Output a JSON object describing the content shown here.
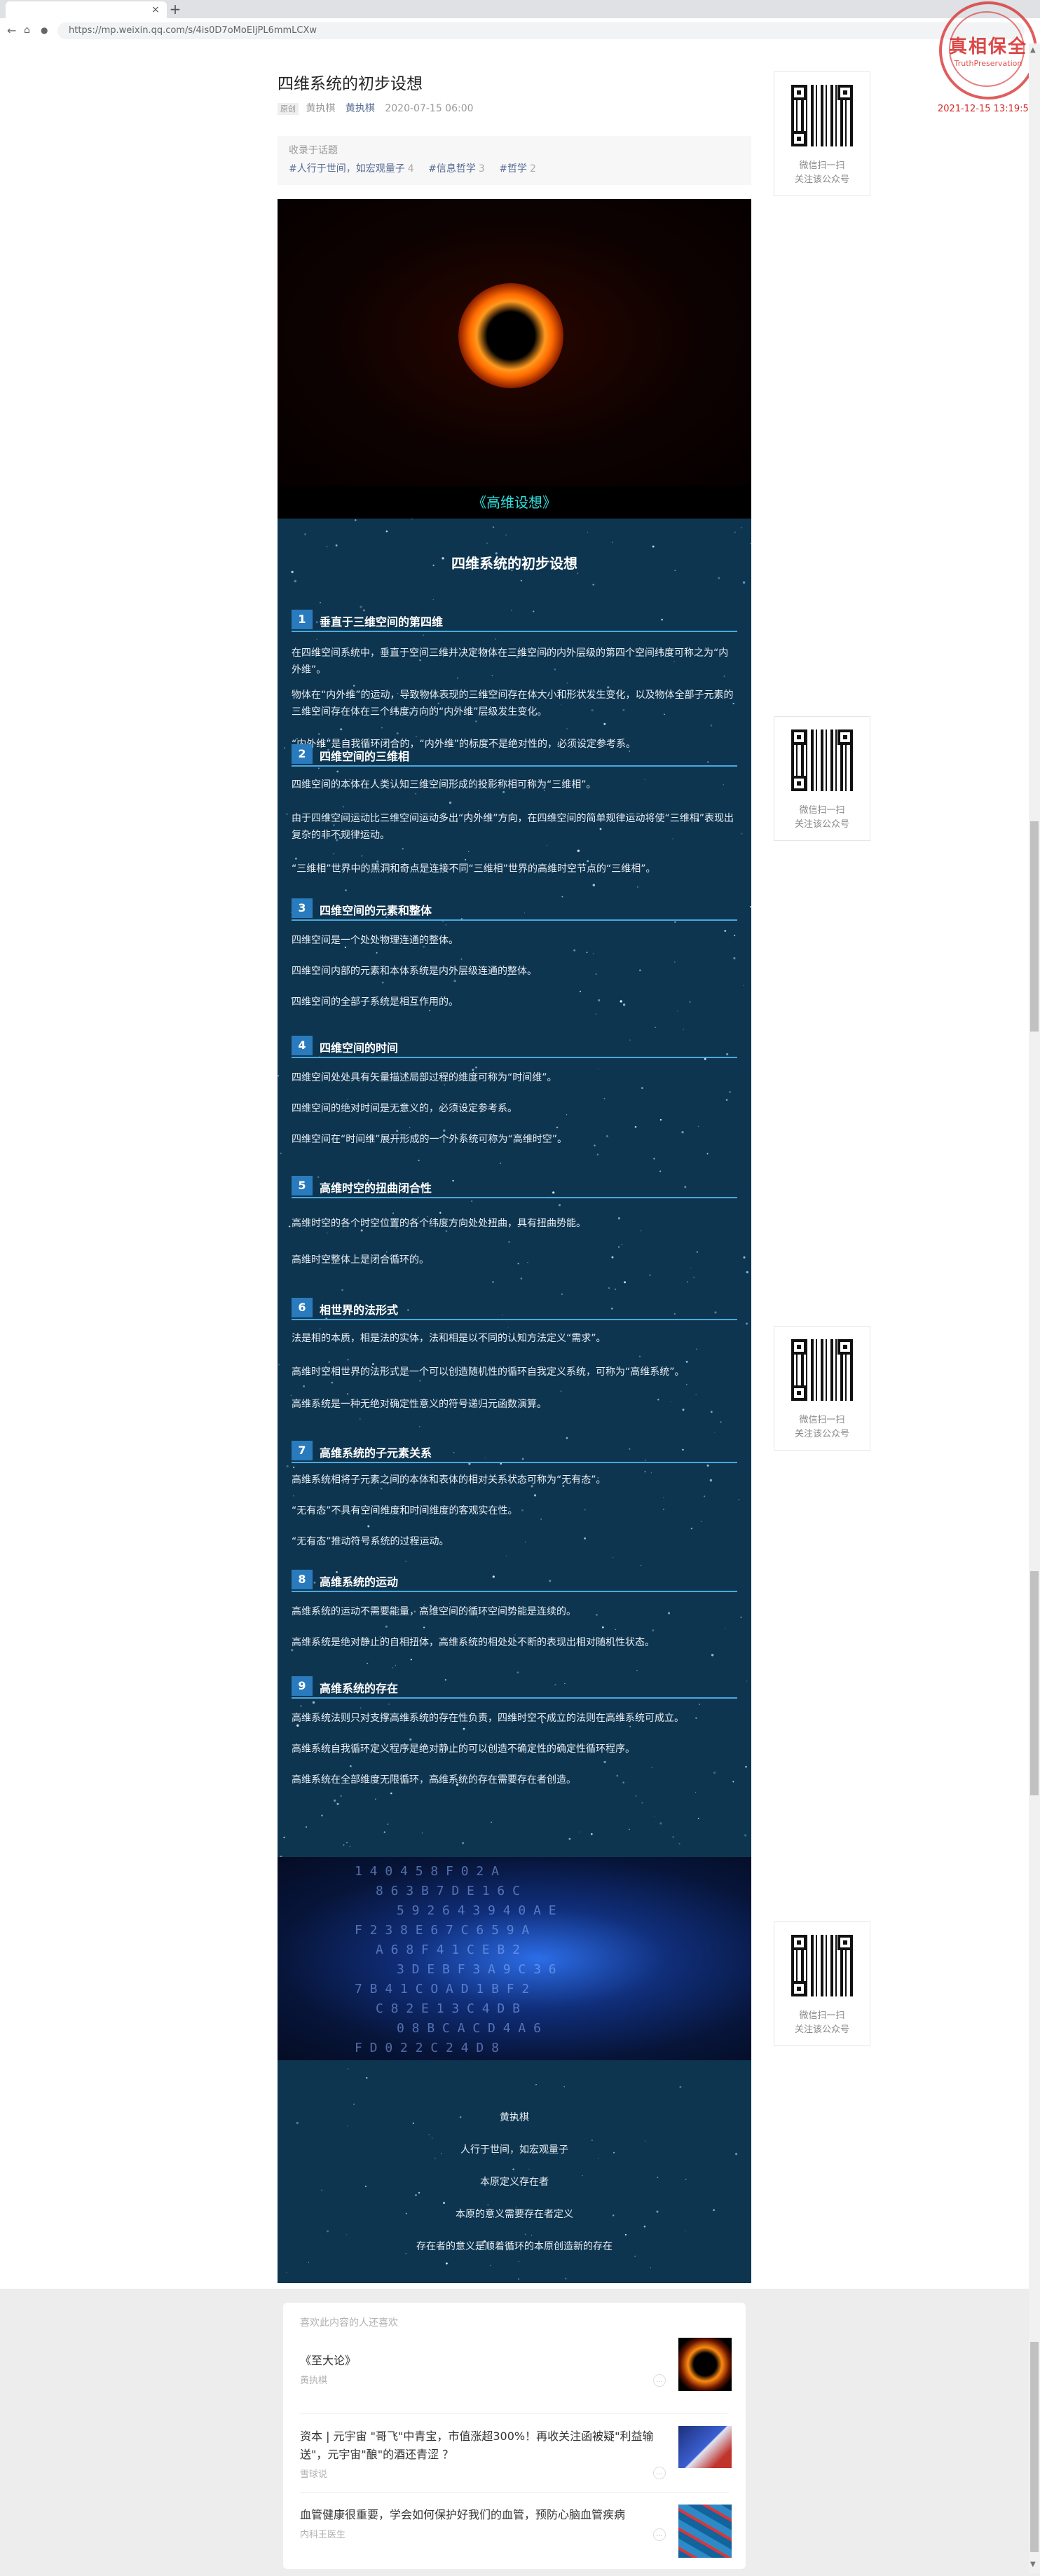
{
  "browser": {
    "url": "https://mp.weixin.qq.com/s/4is0D7oMoEIjPL6mmLCXw",
    "new_tab": "+",
    "tab_close": "×"
  },
  "article": {
    "title": "四维系统的初步设想",
    "original_badge": "原创",
    "author": "黄执棋",
    "account": "黄执棋",
    "date": "2020-07-15 06:00",
    "topic_label": "收录于话题",
    "topics": [
      {
        "name": "#人行于世间，如宏观量子",
        "count": "4"
      },
      {
        "name": "#信息哲学",
        "count": "3"
      },
      {
        "name": "#哲学",
        "count": "2"
      }
    ],
    "hero_caption": "《高维设想》",
    "heading": "四维系统的初步设想",
    "sections": [
      {
        "num": "1",
        "title": "垂直于三维空间的第四维",
        "paras": [
          "在四维空间系统中，垂直于空间三维并决定物体在三维空间的内外层级的第四个空间纬度可称之为“内外维”。",
          "物体在“内外维”的运动，导致物体表现的三维空间存在体大小和形状发生变化，以及物体全部子元素的三维空间存在体在三个纬度方向的“内外维”层级发生变化。",
          "“内外维”是自我循环闭合的，“内外维”的标度不是绝对性的，必须设定参考系。"
        ]
      },
      {
        "num": "2",
        "title": "四维空间的三维相",
        "paras": [
          "四维空间的本体在人类认知三维空间形成的投影称相可称为“三维相”。",
          "由于四维空间运动比三维空间运动多出“内外维”方向，在四维空间的简单规律运动将使“三维相”表现出复杂的非不规律运动。",
          "“三维相”世界中的黑洞和奇点是连接不同“三维相”世界的高维时空节点的“三维相”。"
        ]
      },
      {
        "num": "3",
        "title": "四维空间的元素和整体",
        "paras": [
          "四维空间是一个处处物理连通的整体。",
          "四维空间内部的元素和本体系统是内外层级连通的整体。",
          "四维空间的全部子系统是相互作用的。"
        ]
      },
      {
        "num": "4",
        "title": "四维空间的时间",
        "paras": [
          "四维空间处处具有矢量描述局部过程的维度可称为“时间维”。",
          "四维空间的绝对时间是无意义的，必须设定参考系。",
          "四维空间在“时间维”展开形成的一个外系统可称为“高维时空”。"
        ]
      },
      {
        "num": "5",
        "title": "高维时空的扭曲闭合性",
        "paras": [
          "高维时空的各个时空位置的各个纬度方向处处扭曲，具有扭曲势能。",
          "高维时空整体上是闭合循环的。"
        ]
      },
      {
        "num": "6",
        "title": "相世界的法形式",
        "paras": [
          "法是相的本质，相是法的实体，法和相是以不同的认知方法定义“需求”。",
          "高维时空相世界的法形式是一个可以创造随机性的循环自我定义系统，可称为“高维系统”。",
          "高维系统是一种无绝对确定性意义的符号递归元函数演算。"
        ]
      },
      {
        "num": "7",
        "title": "高维系统的子元素关系",
        "paras": [
          "高维系统相将子元素之间的本体和表体的相对关系状态可称为“无有态”。",
          "“无有态”不具有空间维度和时间维度的客观实在性。",
          "“无有态”推动符号系统的过程运动。"
        ]
      },
      {
        "num": "8",
        "title": "高维系统的运动",
        "paras": [
          "高维系统的运动不需要能量，高维空间的循环空间势能是连续的。",
          "高维系统是绝对静止的自相扭体，高维系统的相处处不断的表现出相对随机性状态。"
        ]
      },
      {
        "num": "9",
        "title": "高维系统的存在",
        "paras": [
          "高维系统法则只对支撑高维系统的存在性负责，四维时空不成立的法则在高维系统可成立。",
          "高维系统自我循环定义程序是绝对静止的可以创造不确定性的确定性循环程序。",
          "高维系统在全部维度无限循环，高维系统的存在需要存在者创造。"
        ]
      }
    ],
    "footer_lines": [
      "黄执棋",
      "人行于世间，如宏观量子",
      "本原定义存在者",
      "本原的意义需要存在者定义",
      "存在者的意义是顺着循环的本原创造新的存在"
    ],
    "code_rows": [
      "1  4  0  4  5  8  F  0  2  A",
      "8  6  3  B  7  D  E  1  6  C",
      "5  9  2  6  4  3  9  4  0  A  E",
      "F  2  3  8  E  6  7  C  6  5  9  A",
      "A  6  8  F  4  1  C  E  B  2",
      "3  D  E  B  F  3  A  9  C  3  6",
      "7  B  4  1  C  O  A  D  1  B  F  2",
      "C  8  2  E  1  3  C  4  D  B",
      "0  8  B  C  A  C  D  4  A  6",
      "F  D  0  2  2  C  2  4  D  8"
    ]
  },
  "qr": {
    "line1": "微信扫一扫",
    "line2": "关注该公众号"
  },
  "stamp": {
    "text": "真相保全",
    "sub": "TruthPreservation",
    "date": "2021-12-15 13:19:57"
  },
  "related": {
    "label": "喜欢此内容的人还喜欢",
    "items": [
      {
        "title": "《至大论》",
        "author": "黄执棋"
      },
      {
        "title": "资本 | 元宇宙 \"哥飞\"中青宝，市值涨超300%！再收关注函被疑\"利益输送\"，元宇宙\"酿\"的酒还青涩 ？",
        "author": "雪球说"
      },
      {
        "title": "血管健康很重要，学会如何保护好我们的血管，预防心脑血管疾病",
        "author": "内科王医生"
      }
    ]
  }
}
